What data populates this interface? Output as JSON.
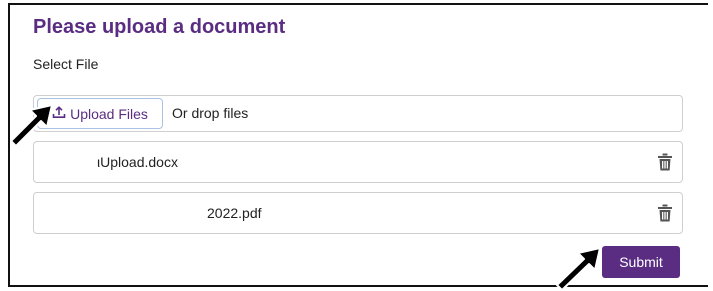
{
  "page": {
    "title": "Please upload a document",
    "select_label": "Select File"
  },
  "upload": {
    "button_label": "Upload Files",
    "drop_text": "Or drop files"
  },
  "files": [
    {
      "name": "ιUpload.docx"
    },
    {
      "name": "2022.pdf"
    }
  ],
  "actions": {
    "submit_label": "Submit"
  },
  "colors": {
    "accent": "#5a2d82",
    "border": "#cfcfcf",
    "icon": "#555555"
  },
  "icons": {
    "upload": "upload-icon",
    "delete": "trash-icon",
    "pointer": "black-arrow-pointer"
  }
}
